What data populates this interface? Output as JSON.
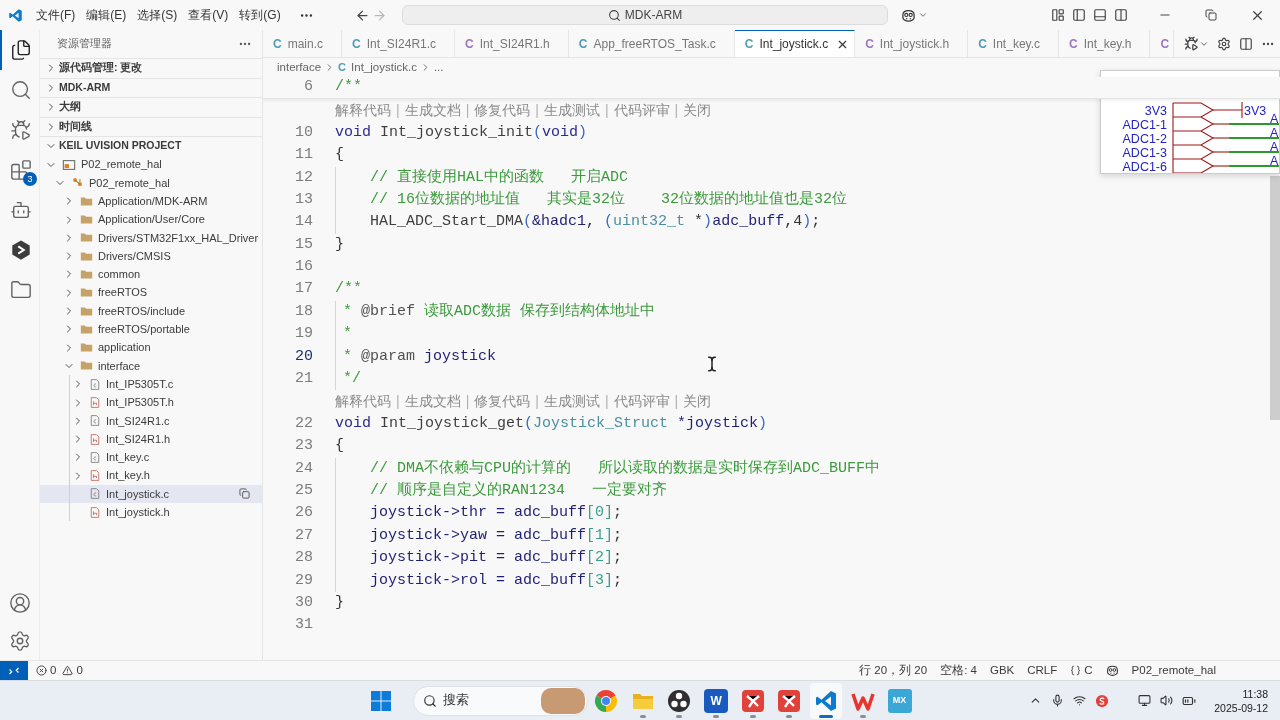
{
  "title_bar": {
    "menu": [
      "文件(F)",
      "编辑(E)",
      "选择(S)",
      "查看(V)",
      "转到(G)"
    ],
    "nav_buttons": [
      {
        "kind": "back",
        "disabled": false
      },
      {
        "kind": "forward",
        "disabled": true
      }
    ],
    "search": {
      "value": "MDK-ARM"
    }
  },
  "activity_bar": {
    "items": [
      {
        "kind": "explorer",
        "selected": true
      },
      {
        "kind": "search",
        "selected": false
      },
      {
        "kind": "run",
        "selected": false
      },
      {
        "kind": "extensions",
        "selected": false,
        "badge": "3"
      },
      {
        "kind": "assistant",
        "selected": false
      },
      {
        "kind": "hexagon",
        "selected": false
      },
      {
        "kind": "folder",
        "selected": false
      }
    ]
  },
  "sidebar": {
    "title": "资源管理器",
    "sections": [
      {
        "title": "源代码管理: 更改",
        "expanded": false
      },
      {
        "title": "MDK-ARM",
        "expanded": false
      },
      {
        "title": "大纲",
        "expanded": false
      },
      {
        "title": "时间线",
        "expanded": false
      },
      {
        "title": "KEIL UVISION PROJECT",
        "expanded": true,
        "tree": [
          {
            "label": "P02_remote_hal",
            "kind": "project",
            "expanded": true,
            "selected": false,
            "children": [
              {
                "label": "P02_remote_hal",
                "kind": "target",
                "expanded": true,
                "selected": false,
                "children": [
                  {
                    "label": "Application/MDK-ARM",
                    "kind": "folder",
                    "expanded": false,
                    "selected": false
                  },
                  {
                    "label": "Application/User/Core",
                    "kind": "folder",
                    "expanded": false,
                    "selected": false
                  },
                  {
                    "label": "Drivers/STM32F1xx_HAL_Driver",
                    "kind": "folder",
                    "expanded": false,
                    "selected": false
                  },
                  {
                    "label": "Drivers/CMSIS",
                    "kind": "folder",
                    "expanded": false,
                    "selected": false
                  },
                  {
                    "label": "common",
                    "kind": "folder",
                    "expanded": false,
                    "selected": false
                  },
                  {
                    "label": "freeRTOS",
                    "kind": "folder",
                    "expanded": false,
                    "selected": false
                  },
                  {
                    "label": "freeRTOS/include",
                    "kind": "folder",
                    "expanded": false,
                    "selected": false
                  },
                  {
                    "label": "freeRTOS/portable",
                    "kind": "folder",
                    "expanded": false,
                    "selected": false
                  },
                  {
                    "label": "application",
                    "kind": "folder",
                    "expanded": false,
                    "selected": false
                  },
                  {
                    "label": "interface",
                    "kind": "folder",
                    "expanded": true,
                    "selected": false,
                    "children": [
                      {
                        "label": "Int_IP5305T.c",
                        "kind": "source",
                        "expanded": false,
                        "selected": false
                      },
                      {
                        "label": "Int_IP5305T.h",
                        "kind": "header",
                        "expanded": false,
                        "selected": false
                      },
                      {
                        "label": "Int_SI24R1.c",
                        "kind": "source",
                        "expanded": false,
                        "selected": false
                      },
                      {
                        "label": "Int_SI24R1.h",
                        "kind": "header",
                        "expanded": false,
                        "selected": false
                      },
                      {
                        "label": "Int_key.c",
                        "kind": "source",
                        "expanded": false,
                        "selected": false
                      },
                      {
                        "label": "Int_key.h",
                        "kind": "header",
                        "expanded": false,
                        "selected": false
                      },
                      {
                        "label": "Int_joystick.c",
                        "kind": "source",
                        "selected": true
                      },
                      {
                        "label": "Int_joystick.h",
                        "kind": "header",
                        "selected": false
                      }
                    ]
                  }
                ]
              }
            ]
          }
        ]
      }
    ]
  },
  "tabs": [
    {
      "glyph": "C",
      "label": "main.c",
      "kind": "source",
      "selected": false
    },
    {
      "glyph": "C",
      "label": "Int_SI24R1.c",
      "kind": "source",
      "selected": false
    },
    {
      "glyph": "C",
      "label": "Int_SI24R1.h",
      "kind": "header",
      "selected": false
    },
    {
      "glyph": "C",
      "label": "App_freeRTOS_Task.c",
      "kind": "source",
      "selected": false
    },
    {
      "glyph": "C",
      "label": "Int_joystick.c",
      "kind": "source",
      "selected": true
    },
    {
      "glyph": "C",
      "label": "Int_joystick.h",
      "kind": "header",
      "selected": false
    },
    {
      "glyph": "C",
      "label": "Int_key.c",
      "kind": "source",
      "selected": false
    },
    {
      "glyph": "C",
      "label": "Int_key.h",
      "kind": "header",
      "selected": false
    },
    {
      "glyph": "C",
      "kind": "header",
      "selected": false
    }
  ],
  "breadcrumb": {
    "items": [
      {
        "label": "interface"
      },
      {
        "glyph": "C",
        "label": "Int_joystick.c"
      }
    ],
    "more": "..."
  },
  "editor": {
    "sticky": {
      "kind": "line",
      "number": "6",
      "current": false,
      "tokens": [
        {
          "kind": "cmt",
          "text": "/**"
        }
      ]
    },
    "lines": [
      {
        "kind": "codelens",
        "actions": [
          "解释代码",
          "生成文档",
          "修复代码",
          "生成测试",
          "代码评审",
          "关闭"
        ],
        "separator": "|"
      },
      {
        "kind": "line",
        "number": "10",
        "current": false,
        "tokens": [
          {
            "kind": "kw",
            "text": "void"
          },
          {
            "kind": "fn",
            "text": " Int_joystick_init"
          },
          {
            "kind": "paren",
            "text": "("
          },
          {
            "kind": "kw",
            "text": "void"
          },
          {
            "kind": "paren",
            "text": ")"
          }
        ]
      },
      {
        "kind": "line",
        "number": "11",
        "current": false,
        "tokens": [
          {
            "kind": "plain",
            "text": "{"
          }
        ]
      },
      {
        "kind": "indented",
        "number": "12",
        "current": false,
        "tokens": [
          {
            "kind": "cmt",
            "text": "// 直接使用HAL中的函数   开启ADC"
          }
        ]
      },
      {
        "kind": "indented",
        "number": "13",
        "current": false,
        "tokens": [
          {
            "kind": "cmt",
            "text": "// 16位数据的地址值   其实是32位    32位数据的地址值也是32位"
          }
        ]
      },
      {
        "kind": "indented",
        "number": "14",
        "current": false,
        "tokens": [
          {
            "kind": "fn",
            "text": "HAL_ADC_Start_DMA"
          },
          {
            "kind": "paren",
            "text": "("
          },
          {
            "kind": "var",
            "text": "&hadc1, "
          },
          {
            "kind": "paren",
            "text": "("
          },
          {
            "kind": "type",
            "text": "uint32_t"
          },
          {
            "kind": "plain",
            "text": " *"
          },
          {
            "kind": "paren",
            "text": ")"
          },
          {
            "kind": "var",
            "text": "adc_buff"
          },
          {
            "kind": "plain",
            "text": ",4"
          },
          {
            "kind": "paren",
            "text": ")"
          },
          {
            "kind": "plain",
            "text": ";"
          }
        ]
      },
      {
        "kind": "line",
        "number": "15",
        "current": false,
        "tokens": [
          {
            "kind": "plain",
            "text": "}"
          }
        ]
      },
      {
        "kind": "line",
        "number": "16",
        "current": false
      },
      {
        "kind": "line",
        "number": "17",
        "current": false,
        "tokens": [
          {
            "kind": "cmt",
            "text": "/**"
          }
        ]
      },
      {
        "kind": "doc",
        "number": "18",
        "current": false,
        "tokens": [
          {
            "kind": "cmt",
            "text": "* "
          },
          {
            "kind": "tag",
            "text": "@brief"
          },
          {
            "kind": "cmt",
            "text": " 读取ADC数据 保存到结构体地址中"
          }
        ]
      },
      {
        "kind": "doc",
        "number": "19",
        "current": false,
        "tokens": [
          {
            "kind": "cmt",
            "text": "*"
          }
        ]
      },
      {
        "kind": "doc",
        "number": "20",
        "current": true,
        "tokens": [
          {
            "kind": "cmt",
            "text": "* "
          },
          {
            "kind": "tag",
            "text": "@param"
          },
          {
            "kind": "var",
            "text": " joystick"
          }
        ]
      },
      {
        "kind": "doc",
        "number": "21",
        "current": false,
        "tokens": [
          {
            "kind": "cmt",
            "text": "*/"
          }
        ]
      },
      {
        "kind": "codelens",
        "actions": [
          "解释代码",
          "生成文档",
          "修复代码",
          "生成测试",
          "代码评审",
          "关闭"
        ],
        "separator": "|"
      },
      {
        "kind": "line",
        "number": "22",
        "current": false,
        "tokens": [
          {
            "kind": "kw",
            "text": "void"
          },
          {
            "kind": "fn",
            "text": " Int_joystick_get"
          },
          {
            "kind": "paren",
            "text": "("
          },
          {
            "kind": "type",
            "text": "Joystick_Struct"
          },
          {
            "kind": "var",
            "text": " *joystick"
          },
          {
            "kind": "paren",
            "text": ")"
          }
        ]
      },
      {
        "kind": "line",
        "number": "23",
        "current": false,
        "tokens": [
          {
            "kind": "plain",
            "text": "{"
          }
        ]
      },
      {
        "kind": "indented",
        "number": "24",
        "current": false,
        "tokens": [
          {
            "kind": "cmt",
            "text": "// DMA不依赖与CPU的计算的   所以读取的数据是实时保存到ADC_BUFF中"
          }
        ]
      },
      {
        "kind": "indented",
        "number": "25",
        "current": false,
        "tokens": [
          {
            "kind": "cmt",
            "text": "// 顺序是自定义的RAN1234   一定要对齐"
          }
        ]
      },
      {
        "kind": "indented",
        "number": "26",
        "current": false,
        "tokens": [
          {
            "kind": "var",
            "text": "joystick->thr = adc_buff"
          },
          {
            "kind": "bracket",
            "text": "[0]"
          },
          {
            "kind": "plain",
            "text": ";"
          }
        ]
      },
      {
        "kind": "indented",
        "number": "27",
        "current": false,
        "tokens": [
          {
            "kind": "var",
            "text": "joystick->yaw = adc_buff"
          },
          {
            "kind": "bracket",
            "text": "[1]"
          },
          {
            "kind": "plain",
            "text": ";"
          }
        ]
      },
      {
        "kind": "indented",
        "number": "28",
        "current": false,
        "tokens": [
          {
            "kind": "var",
            "text": "joystick->pit = adc_buff"
          },
          {
            "kind": "bracket",
            "text": "[2]"
          },
          {
            "kind": "plain",
            "text": ";"
          }
        ]
      },
      {
        "kind": "indented",
        "number": "29",
        "current": false,
        "tokens": [
          {
            "kind": "var",
            "text": "joystick->rol = adc_buff"
          },
          {
            "kind": "bracket",
            "text": "[3]"
          },
          {
            "kind": "plain",
            "text": ";"
          }
        ]
      },
      {
        "kind": "line",
        "number": "30",
        "current": false,
        "tokens": [
          {
            "kind": "plain",
            "text": "}"
          }
        ]
      },
      {
        "kind": "line",
        "number": "31",
        "current": false
      }
    ]
  },
  "schematic": {
    "pins": [
      "3V3",
      "ADC1-1",
      "ADC1-2",
      "ADC1-3",
      "ADC1-6"
    ],
    "power_label": "3V3",
    "net_labels": [
      "A",
      "A",
      "A",
      "A"
    ]
  },
  "status_bar": {
    "problems": [
      {
        "kind": "error",
        "count": "0"
      },
      {
        "kind": "warning",
        "count": "0"
      }
    ],
    "items": [
      {
        "kind": "text",
        "label": "行 20，列 20"
      },
      {
        "kind": "text",
        "label": "空格: 4"
      },
      {
        "kind": "text",
        "label": "GBK"
      },
      {
        "kind": "text",
        "label": "CRLF"
      },
      {
        "kind": "language",
        "label": "C"
      },
      {
        "kind": "assistant"
      },
      {
        "kind": "text",
        "label": "P02_remote_hal"
      }
    ]
  },
  "taskbar": {
    "search": {
      "placeholder": "搜索"
    },
    "apps": [
      {
        "kind": "browser",
        "running": false,
        "active": false
      },
      {
        "kind": "files",
        "running": true,
        "active": false
      },
      {
        "kind": "recorder",
        "running": true,
        "active": false
      },
      {
        "kind": "document",
        "label": "W",
        "running": true,
        "active": false
      },
      {
        "kind": "mindmap",
        "running": true,
        "active": false
      },
      {
        "kind": "mindmap",
        "running": true,
        "active": false
      },
      {
        "kind": "editor",
        "running": true,
        "active": true
      },
      {
        "kind": "office",
        "running": true,
        "active": false
      },
      {
        "kind": "tile",
        "label": "MX",
        "running": false,
        "active": false
      }
    ],
    "clock": {
      "time": "11:38",
      "date": "2025-09-12"
    }
  }
}
